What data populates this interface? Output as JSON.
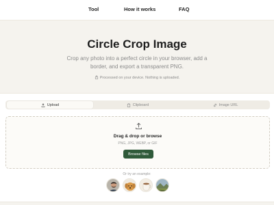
{
  "nav": {
    "tool": "Tool",
    "how_it_works": "How it works",
    "faq": "FAQ"
  },
  "hero": {
    "title": "Circle Crop Image",
    "subtitle": "Crop any photo into a perfect circle in your browser, add a border, and export a transparent PNG.",
    "privacy_note": "Processed on your device. Nothing is uploaded.",
    "privacy_icon": "lock-icon"
  },
  "tabs": [
    {
      "label": "Upload",
      "icon": "upload-icon",
      "active": true
    },
    {
      "label": "Clipboard",
      "icon": "clipboard-icon",
      "active": false
    },
    {
      "label": "Image URL",
      "icon": "link-icon",
      "active": false
    }
  ],
  "dropzone": {
    "title": "Drag & drop or browse",
    "formats": "PNG, JPG, WEBP, or GIF",
    "button": "Browse files",
    "icon": "upload-icon"
  },
  "examples": {
    "label": "Or try an example:",
    "items": [
      {
        "name": "man-portrait-example"
      },
      {
        "name": "dog-example"
      },
      {
        "name": "coffee-cup-example"
      },
      {
        "name": "landscape-example"
      }
    ]
  },
  "colors": {
    "page_bg": "#f5f3ee",
    "button_bg": "#2f5a3a",
    "muted_text": "#8a8a8a"
  }
}
